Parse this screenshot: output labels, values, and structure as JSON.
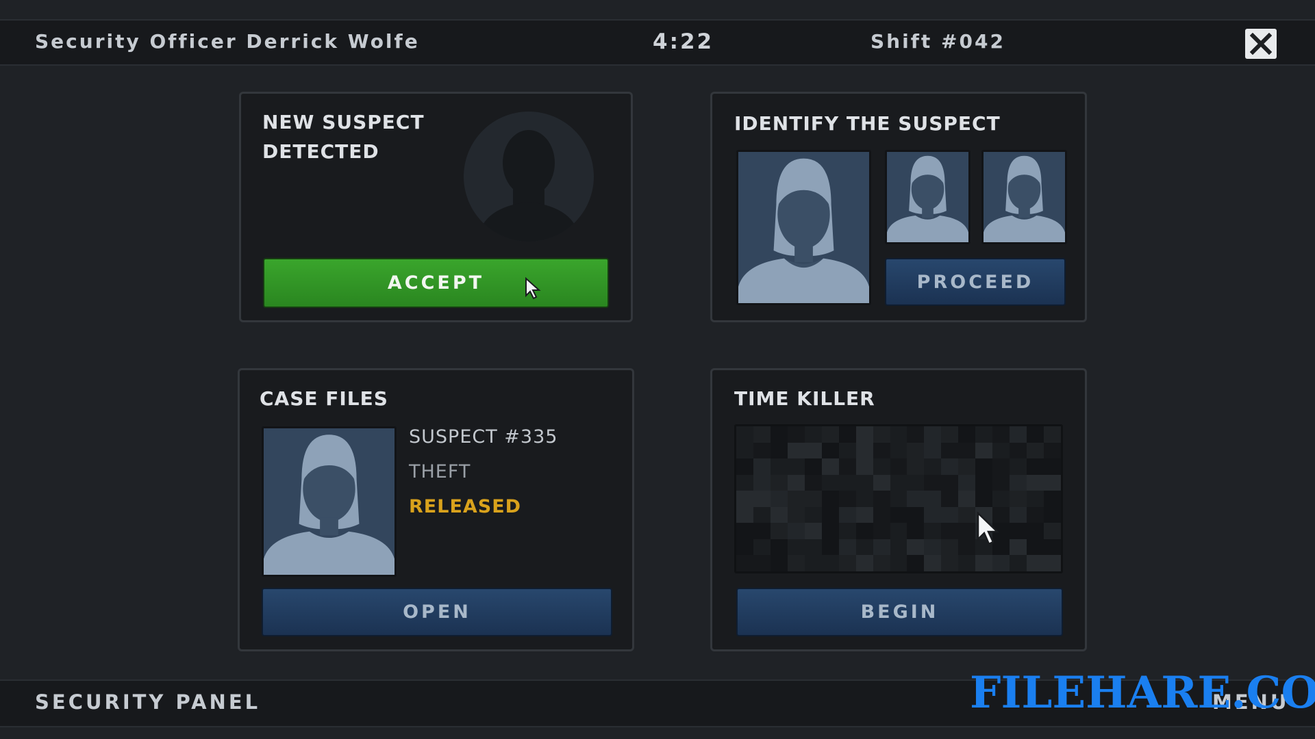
{
  "header": {
    "officer": "Security Officer  Derrick Wolfe",
    "timer": "4:22",
    "shift": "Shift  #042"
  },
  "new_suspect": {
    "title_line1": "NEW SUSPECT",
    "title_line2": "DETECTED",
    "accept_label": "ACCEPT"
  },
  "identify": {
    "title": "IDENTIFY THE SUSPECT",
    "proceed_label": "PROCEED"
  },
  "case_files": {
    "title": "CASE FILES",
    "suspect_id": "SUSPECT #335",
    "crime": "THEFT",
    "status": "RELEASED",
    "open_label": "OPEN"
  },
  "time_killer": {
    "title": "TIME KILLER",
    "begin_label": "BEGIN"
  },
  "footer": {
    "panel_label": "SECURITY PANEL",
    "menu_label": "MENU"
  },
  "watermark": "FILEHARE.COM",
  "colors": {
    "accept_green": "#2f9a24",
    "button_blue": "#213c5f",
    "status_released": "#d9a21c",
    "portrait_bg": "#33465d",
    "silhouette": "#8ea2b8"
  },
  "icons": [
    "close-icon",
    "cursor-arrow-icon",
    "silhouette-icon"
  ]
}
